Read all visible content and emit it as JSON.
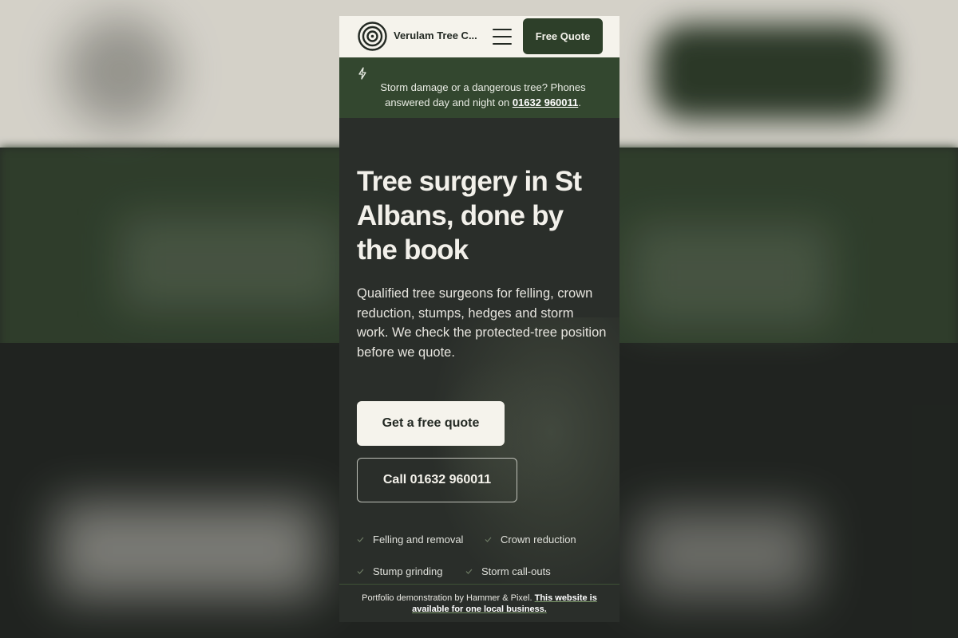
{
  "header": {
    "brand": "Verulam Tree C...",
    "cta_label": "Free Quote"
  },
  "alert": {
    "text_before": "Storm damage or a dangerous tree? Phones answered day and night on ",
    "phone": "01632 960011",
    "text_after": "."
  },
  "hero": {
    "title": "Tree surgery in St Albans, done by the book",
    "subtitle": "Qualified tree surgeons for felling, crown reduction, stumps, hedges and storm work. We check the protected-tree position before we quote.",
    "primary_cta": "Get a free quote",
    "secondary_cta": "Call 01632 960011",
    "features": [
      "Felling and removal",
      "Crown reduction",
      "Stump grinding",
      "Storm call-outs"
    ]
  },
  "footer": {
    "text": "Portfolio demonstration by Hammer & Pixel.",
    "link": "This website is available for one local business."
  },
  "colors": {
    "brand_green": "#2d3f29",
    "alert_green": "#33472f",
    "cream": "#f5f3ec",
    "hero_bg": "#2a2e2a"
  },
  "icons": [
    "target-logo-icon",
    "hamburger-menu-icon",
    "lightning-icon",
    "checkmark-icon"
  ]
}
